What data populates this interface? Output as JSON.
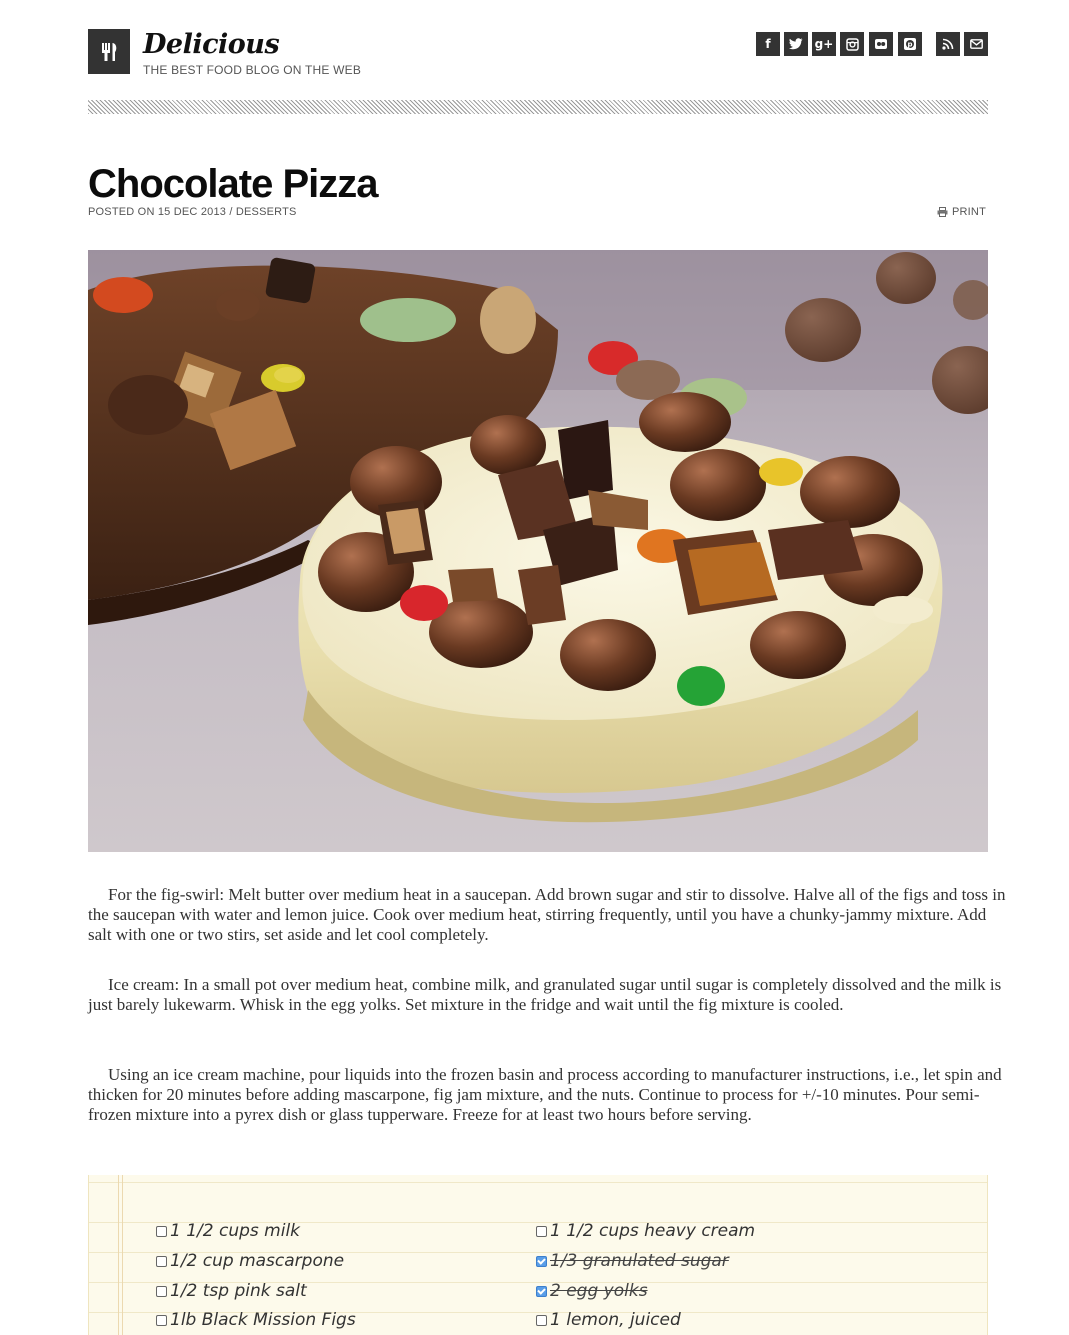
{
  "header": {
    "site_title": "Delicious",
    "tagline": "THE BEST FOOD BLOG ON THE WEB",
    "logo_icon": "fork-knife-icon",
    "social": [
      {
        "name": "facebook-icon",
        "glyph": "f"
      },
      {
        "name": "twitter-icon",
        "glyph": "t"
      },
      {
        "name": "google-plus-icon",
        "glyph": "g+"
      },
      {
        "name": "instagram-icon",
        "glyph": "◘"
      },
      {
        "name": "flickr-icon",
        "glyph": "••"
      },
      {
        "name": "pinterest-icon",
        "glyph": "p"
      },
      {
        "name": "rss-icon",
        "glyph": "≋"
      },
      {
        "name": "email-icon",
        "glyph": "✉"
      }
    ]
  },
  "post": {
    "title": "Chocolate Pizza",
    "meta": "POSTED ON 15 DEC 2013 / DESSERTS",
    "print_label": "PRINT",
    "paragraphs": [
      "For the fig-swirl: Melt butter over medium heat in a saucepan. Add brown sugar and stir to dissolve. Halve all of the figs and toss in the saucepan with water and lemon juice. Cook over medium heat, stirring frequently, until you have a chunky-jammy mixture. Add salt with one or two stirs, set aside and let cool completely.",
      "Ice cream: In a small pot over medium heat, combine milk, and granulated sugar until sugar is completely dissolved and the milk is just barely lukewarm. Whisk in the egg yolks. Set mixture in the fridge and wait until the fig mixture is cooled.",
      "Using an ice cream machine, pour liquids into the frozen basin and process according to manufacturer instructions, i.e., let spin and thicken for 20 minutes before adding mascarpone, fig jam mixture, and the nuts. Continue to process for +/-10 minutes. Pour semi-frozen mixture into a pyrex dish or glass tupperware. Freeze for at least two hours before serving."
    ]
  },
  "ingredients": {
    "left": [
      {
        "label": " 1 1/2 cups milk",
        "checked": false
      },
      {
        "label": "1/2 cup mascarpone",
        "checked": false
      },
      {
        "label": "1/2 tsp pink salt",
        "checked": false
      },
      {
        "label": "1lb Black Mission Figs",
        "checked": false
      }
    ],
    "right": [
      {
        "label": "1 1/2 cups heavy cream",
        "checked": false
      },
      {
        "label": "1/3 granulated sugar",
        "checked": true
      },
      {
        "label": "2 egg yolks",
        "checked": true
      },
      {
        "label": "1 lemon, juiced",
        "checked": false
      }
    ]
  }
}
